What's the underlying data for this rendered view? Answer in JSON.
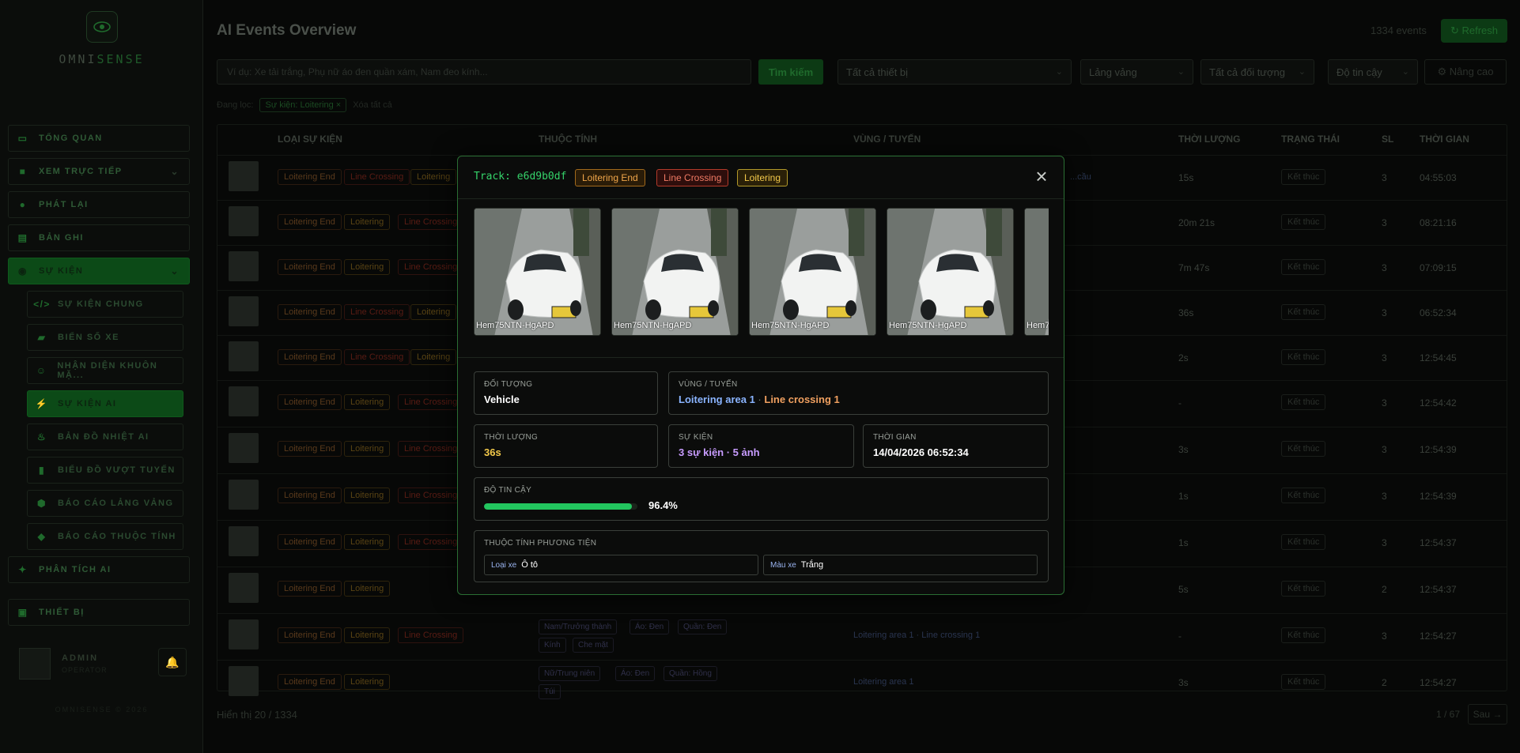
{
  "app": {
    "logo_prefix": "OMNI",
    "logo_suffix": "SENSE",
    "version": "OMNISENSE © 2026"
  },
  "sidebar": {
    "items": [
      {
        "label": "TỔNG QUAN",
        "icon": "monitor-icon"
      },
      {
        "label": "XEM TRỰC TIẾP",
        "icon": "video-icon"
      },
      {
        "label": "PHÁT LẠI",
        "icon": "play-icon"
      },
      {
        "label": "BẢN GHI",
        "icon": "database-icon"
      },
      {
        "label": "SỰ KIỆN",
        "icon": "camera-icon"
      }
    ],
    "sub_items": [
      {
        "label": "SỰ KIỆN CHUNG",
        "icon": "code-icon"
      },
      {
        "label": "BIỂN SỐ XE",
        "icon": "car-icon"
      },
      {
        "label": "NHẬN DIỆN KHUÔN MẶ...",
        "icon": "face-icon"
      },
      {
        "label": "SỰ KIỆN AI",
        "icon": "bolt-icon"
      },
      {
        "label": "BẢN ĐỒ NHIỆT AI",
        "icon": "flame-icon"
      },
      {
        "label": "BIỂU ĐỒ VƯỢT TUYẾN",
        "icon": "bar-chart-icon"
      },
      {
        "label": "BÁO CÁO LẢNG VẢNG",
        "icon": "shield-icon"
      },
      {
        "label": "BÁO CÁO THUỘC TÍNH",
        "icon": "tag-icon"
      }
    ],
    "bottom_items": [
      {
        "label": "PHÂN TÍCH AI",
        "icon": "sparkle-icon"
      },
      {
        "label": "THIẾT BỊ",
        "icon": "device-icon"
      }
    ],
    "user": {
      "name": "ADMIN",
      "role": "OPERATOR"
    }
  },
  "header": {
    "title": "AI Events Overview",
    "event_count": "1334 events",
    "refresh_label": "↻ Refresh"
  },
  "filters": {
    "search_placeholder": "Ví dụ: Xe tải trắng, Phụ nữ áo đen quần xám, Nam đeo kính...",
    "search_button": "Tìm kiếm",
    "device_select": "Tất cả thiết bị",
    "event_select": "Lảng vảng",
    "object_select": "Tất cả đối tượng",
    "confidence_select": "Độ tin cậy",
    "advanced_button": "⚙ Nâng cao",
    "active_label": "Đang lọc:",
    "active_chip": "Sự kiện: Loitering ×",
    "clear_label": "Xóa tất cả"
  },
  "table": {
    "headers": [
      "LOẠI SỰ KIỆN",
      "THUỘC TÍNH",
      "VÙNG / TUYẾN",
      "THỜI LƯỢNG",
      "TRẠNG THÁI",
      "SL",
      "THỜI GIAN"
    ],
    "rows": [
      {
        "tags": [
          "Loitering End",
          "Line Crossing",
          "Loitering"
        ],
        "duration": "15s",
        "status": "Kết thúc",
        "sl": "3",
        "time": "04:55:03"
      },
      {
        "tags": [
          "Loitering End",
          "Loitering",
          "Line Crossing"
        ],
        "duration": "20m 21s",
        "status": "Kết thúc",
        "sl": "3",
        "time": "08:21:16"
      },
      {
        "tags": [
          "Loitering End",
          "Loitering",
          "Line Crossing"
        ],
        "duration": "7m 47s",
        "status": "Kết thúc",
        "sl": "3",
        "time": "07:09:15"
      },
      {
        "tags": [
          "Loitering End",
          "Line Crossing",
          "Loitering"
        ],
        "duration": "36s",
        "status": "Kết thúc",
        "sl": "3",
        "time": "06:52:34"
      },
      {
        "tags": [
          "Loitering End",
          "Line Crossing",
          "Loitering"
        ],
        "duration": "2s",
        "status": "Kết thúc",
        "sl": "3",
        "time": "12:54:45"
      },
      {
        "tags": [
          "Loitering End",
          "Loitering",
          "Line Crossing"
        ],
        "duration": "-",
        "status": "Kết thúc",
        "sl": "3",
        "time": "12:54:42"
      },
      {
        "tags": [
          "Loitering End",
          "Loitering",
          "Line Crossing"
        ],
        "duration": "3s",
        "status": "Kết thúc",
        "sl": "3",
        "time": "12:54:39"
      },
      {
        "tags": [
          "Loitering End",
          "Loitering",
          "Line Crossing"
        ],
        "duration": "1s",
        "status": "Kết thúc",
        "sl": "3",
        "time": "12:54:39"
      },
      {
        "tags": [
          "Loitering End",
          "Loitering",
          "Line Crossing"
        ],
        "duration": "1s",
        "status": "Kết thúc",
        "sl": "3",
        "time": "12:54:37"
      },
      {
        "tags": [
          "Loitering End",
          "Loitering"
        ],
        "duration": "5s",
        "status": "Kết thúc",
        "sl": "2",
        "time": "12:54:37"
      },
      {
        "tags": [
          "Loitering End",
          "Loitering",
          "Line Crossing"
        ],
        "attrs": [
          "Nam/Trưởng thành",
          "Áo: Đen",
          "Quần: Đen",
          "Kính",
          "Che mặt"
        ],
        "area": "Loitering area 1 · Line crossing 1",
        "duration": "-",
        "status": "Kết thúc",
        "sl": "3",
        "time": "12:54:27"
      },
      {
        "tags": [
          "Loitering End",
          "Loitering"
        ],
        "attrs": [
          "Nữ/Trung niên",
          "Áo: Đen",
          "Quần: Hồng",
          "Túi"
        ],
        "area": "Loitering area 1",
        "duration": "3s",
        "status": "Kết thúc",
        "sl": "2",
        "time": "12:54:27"
      }
    ],
    "row0_area_partial": "...cầu",
    "footer_count": "Hiển thị 20 / 1334",
    "page_indicator": "1 / 67",
    "next_label": "Sau →"
  },
  "modal": {
    "track_label": "Track: e6d9b0df",
    "tags": [
      "Loitering End",
      "Line Crossing",
      "Loitering"
    ],
    "image_label": "Hem75NTN-HgAPD",
    "object": {
      "label": "ĐỐI TƯỢNG",
      "value": "Vehicle"
    },
    "zone": {
      "label": "VÙNG / TUYẾN",
      "area": "Loitering area 1",
      "sep": " · ",
      "line": "Line crossing 1"
    },
    "duration": {
      "label": "THỜI LƯỢNG",
      "value": "36s"
    },
    "events": {
      "label": "SỰ KIỆN",
      "value": "3 sự kiện · 5 ảnh"
    },
    "time": {
      "label": "THỜI GIAN",
      "value": "14/04/2026 06:52:34"
    },
    "confidence": {
      "label": "ĐỘ TIN CẬY",
      "value": "96.4%",
      "fraction": 0.964
    },
    "vehicle_attrs": {
      "label": "THUỘC TÍNH PHƯƠNG TIỆN",
      "type_key": "Loại xe",
      "type_val": "Ô tô",
      "color_key": "Màu xe",
      "color_val": "Trắng"
    }
  },
  "colors": {
    "accent": "#22c55e",
    "track": "#35d36a",
    "loitering_end": "#f0a64a",
    "line_crossing": "#f07a64",
    "loitering": "#f3c94a",
    "zone_area": "#8ab4ff",
    "zone_line": "#f0a060",
    "duration": "#f3c94a",
    "events": "#c89cff"
  }
}
